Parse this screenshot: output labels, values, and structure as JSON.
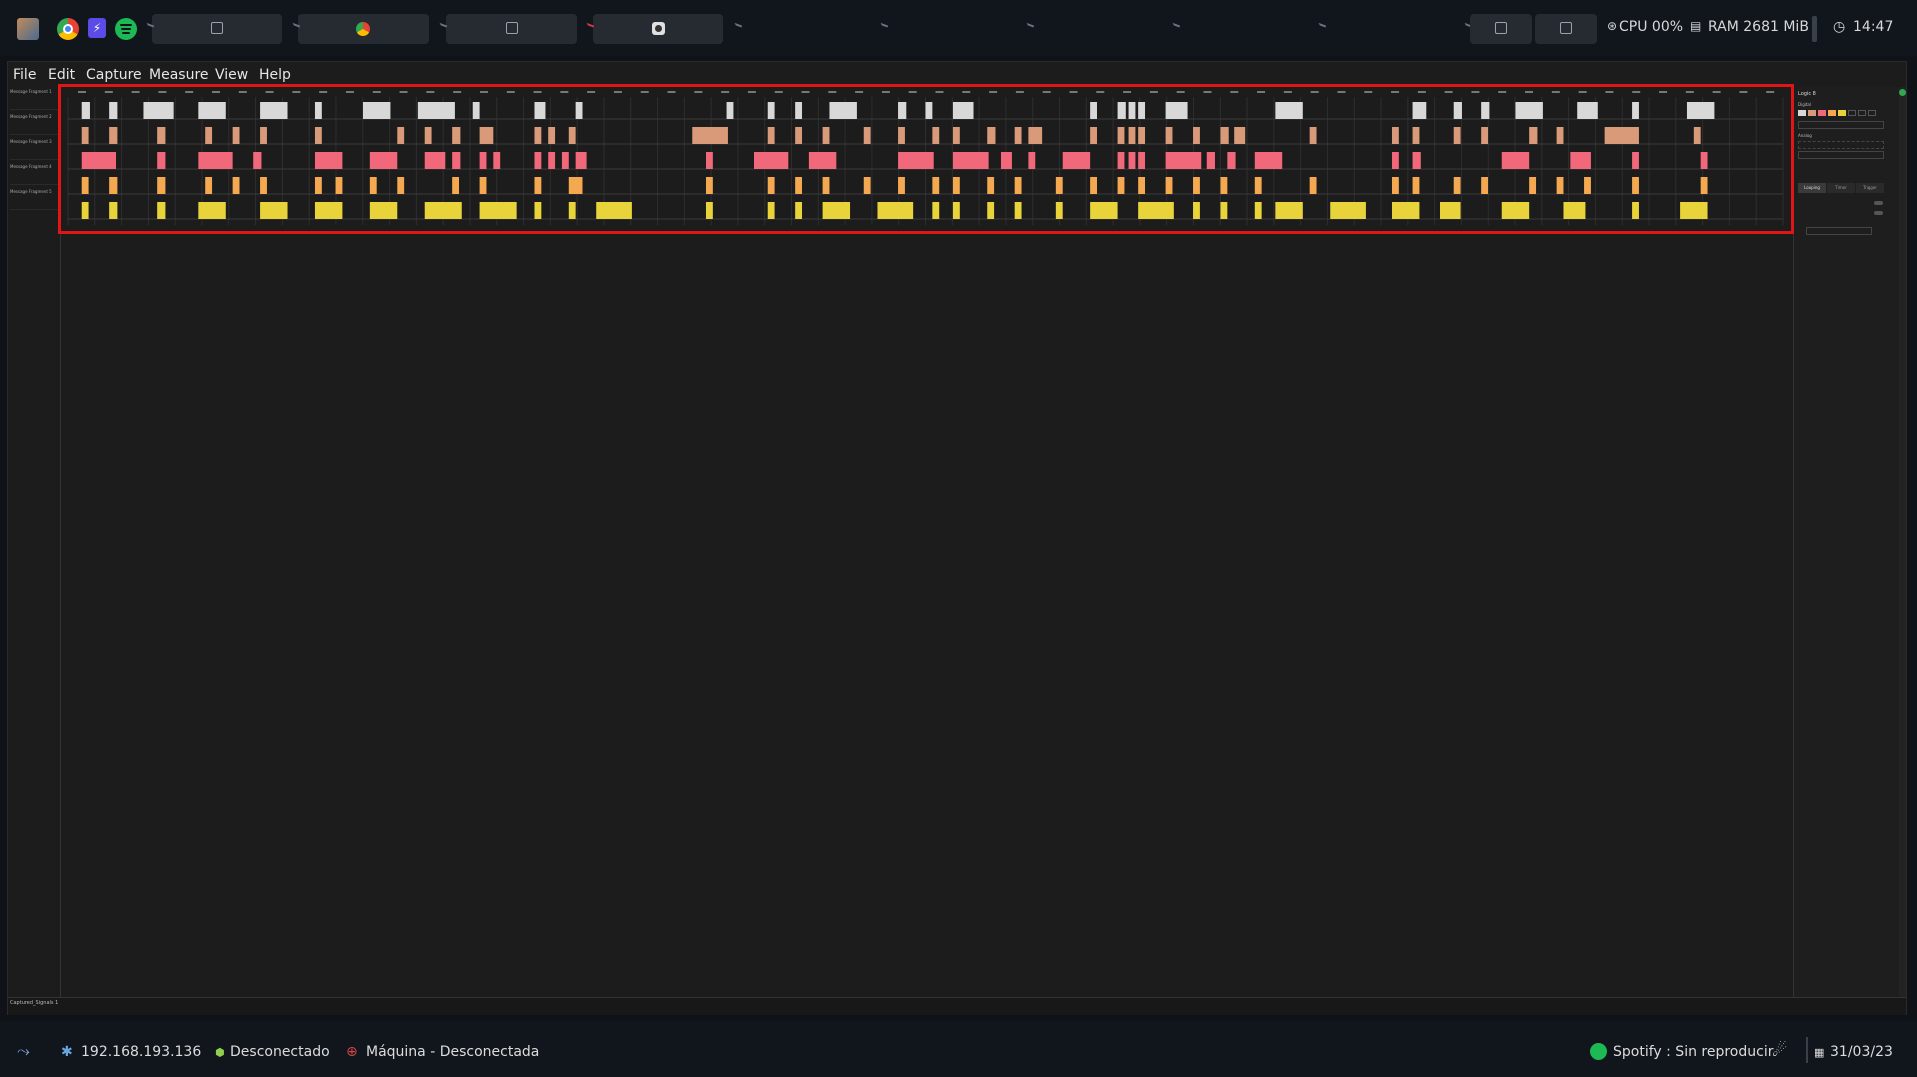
{
  "topbar": {
    "apps": [
      {
        "name": "kali-logo-icon"
      },
      {
        "name": "chrome-icon"
      },
      {
        "name": "burp-icon"
      },
      {
        "name": "spotify-icon"
      }
    ],
    "windows": [
      "terminal",
      "chrome",
      "terminal",
      "logic"
    ],
    "right_windows": [
      "terminal",
      "terminal"
    ],
    "cpu": "CPU 00%",
    "ram": "RAM 2681 MiB",
    "clock": "14:47"
  },
  "menu": [
    "File",
    "Edit",
    "Capture",
    "Measure",
    "View",
    "Help"
  ],
  "channels": [
    {
      "label": "Message Fragment 1",
      "color": "#d8d8d8"
    },
    {
      "label": "Message Fragment 2",
      "color": "#d99a7a"
    },
    {
      "label": "Message Fragment 3",
      "color": "#f0687a"
    },
    {
      "label": "Message Fragment 4",
      "color": "#f4a850"
    },
    {
      "label": "Message Fragment 5",
      "color": "#e8d43a"
    }
  ],
  "pulses": [
    [
      [
        1.0,
        0.6
      ],
      [
        3.0,
        0.6
      ],
      [
        5.5,
        2.2
      ],
      [
        9.5,
        2.0
      ],
      [
        14.0,
        2.0
      ],
      [
        18.0,
        0.5
      ],
      [
        21.5,
        2.0
      ],
      [
        25.5,
        2.7
      ],
      [
        29.5,
        0.5
      ],
      [
        34.0,
        0.8
      ],
      [
        37.0,
        0.5
      ],
      [
        48.0,
        0.5
      ],
      [
        51.0,
        0.5
      ],
      [
        53.0,
        0.5
      ],
      [
        55.5,
        2.0
      ],
      [
        60.5,
        0.6
      ],
      [
        62.5,
        0.5
      ],
      [
        64.5,
        1.5
      ],
      [
        74.5,
        0.5
      ],
      [
        76.5,
        0.6
      ],
      [
        77.3,
        0.5
      ],
      [
        78.0,
        0.5
      ],
      [
        80.0,
        1.6
      ],
      [
        88.0,
        2.0
      ],
      [
        98.0,
        1.0
      ],
      [
        101.0,
        0.6
      ],
      [
        103.0,
        0.6
      ],
      [
        105.5,
        2.0
      ],
      [
        110.0,
        1.5
      ],
      [
        114.0,
        0.5
      ],
      [
        118.0,
        2.0
      ]
    ],
    [
      [
        1.0,
        0.5
      ],
      [
        3.0,
        0.6
      ],
      [
        6.5,
        0.6
      ],
      [
        10.0,
        0.5
      ],
      [
        12.0,
        0.5
      ],
      [
        14.0,
        0.5
      ],
      [
        18.0,
        0.5
      ],
      [
        24.0,
        0.5
      ],
      [
        26.0,
        0.5
      ],
      [
        28.0,
        0.6
      ],
      [
        30.0,
        1.0
      ],
      [
        34.0,
        0.5
      ],
      [
        35.0,
        0.5
      ],
      [
        36.5,
        0.5
      ],
      [
        45.5,
        2.6
      ],
      [
        51.0,
        0.5
      ],
      [
        53.0,
        0.5
      ],
      [
        55.0,
        0.5
      ],
      [
        58.0,
        0.5
      ],
      [
        60.5,
        0.5
      ],
      [
        63.0,
        0.5
      ],
      [
        64.5,
        0.5
      ],
      [
        67.0,
        0.6
      ],
      [
        69.0,
        0.5
      ],
      [
        70.0,
        1.0
      ],
      [
        74.5,
        0.5
      ],
      [
        76.5,
        0.5
      ],
      [
        77.3,
        0.5
      ],
      [
        78.0,
        0.5
      ],
      [
        80.0,
        0.5
      ],
      [
        82.0,
        0.5
      ],
      [
        84.0,
        0.6
      ],
      [
        85.0,
        0.8
      ],
      [
        90.5,
        0.5
      ],
      [
        96.5,
        0.5
      ],
      [
        98.0,
        0.5
      ],
      [
        101.0,
        0.5
      ],
      [
        103.0,
        0.5
      ],
      [
        106.5,
        0.6
      ],
      [
        108.5,
        0.5
      ],
      [
        112.0,
        2.5
      ],
      [
        118.5,
        0.5
      ]
    ],
    [
      [
        1.0,
        2.5
      ],
      [
        6.5,
        0.6
      ],
      [
        9.5,
        2.5
      ],
      [
        13.5,
        0.6
      ],
      [
        18.0,
        2.0
      ],
      [
        22.0,
        2.0
      ],
      [
        26.0,
        1.5
      ],
      [
        28.0,
        0.6
      ],
      [
        30.0,
        0.5
      ],
      [
        31.0,
        0.5
      ],
      [
        34.0,
        0.5
      ],
      [
        35.0,
        0.5
      ],
      [
        36.0,
        0.5
      ],
      [
        37.0,
        0.8
      ],
      [
        46.5,
        0.5
      ],
      [
        50.0,
        2.5
      ],
      [
        54.0,
        2.0
      ],
      [
        60.5,
        2.6
      ],
      [
        64.5,
        2.6
      ],
      [
        68.0,
        0.8
      ],
      [
        70.0,
        0.5
      ],
      [
        72.5,
        2.0
      ],
      [
        76.5,
        0.5
      ],
      [
        77.3,
        0.5
      ],
      [
        78.0,
        0.5
      ],
      [
        80.0,
        2.6
      ],
      [
        83.0,
        0.6
      ],
      [
        84.5,
        0.6
      ],
      [
        86.5,
        2.0
      ],
      [
        96.5,
        0.5
      ],
      [
        98.0,
        0.6
      ],
      [
        104.5,
        2.0
      ],
      [
        109.5,
        1.5
      ],
      [
        114.0,
        0.5
      ],
      [
        119.0,
        0.5
      ]
    ],
    [
      [
        1.0,
        0.5
      ],
      [
        3.0,
        0.6
      ],
      [
        6.5,
        0.6
      ],
      [
        10.0,
        0.5
      ],
      [
        12.0,
        0.5
      ],
      [
        14.0,
        0.5
      ],
      [
        18.0,
        0.5
      ],
      [
        19.5,
        0.5
      ],
      [
        22.0,
        0.5
      ],
      [
        24.0,
        0.5
      ],
      [
        28.0,
        0.5
      ],
      [
        30.0,
        0.5
      ],
      [
        34.0,
        0.5
      ],
      [
        36.5,
        1.0
      ],
      [
        46.5,
        0.5
      ],
      [
        51.0,
        0.5
      ],
      [
        53.0,
        0.5
      ],
      [
        55.0,
        0.5
      ],
      [
        58.0,
        0.5
      ],
      [
        60.5,
        0.5
      ],
      [
        63.0,
        0.5
      ],
      [
        64.5,
        0.5
      ],
      [
        67.0,
        0.5
      ],
      [
        69.0,
        0.5
      ],
      [
        72.0,
        0.5
      ],
      [
        74.5,
        0.5
      ],
      [
        76.5,
        0.5
      ],
      [
        78.0,
        0.5
      ],
      [
        80.0,
        0.5
      ],
      [
        82.0,
        0.5
      ],
      [
        84.0,
        0.5
      ],
      [
        86.5,
        0.5
      ],
      [
        90.5,
        0.5
      ],
      [
        96.5,
        0.5
      ],
      [
        98.0,
        0.5
      ],
      [
        101.0,
        0.5
      ],
      [
        103.0,
        0.5
      ],
      [
        106.5,
        0.5
      ],
      [
        108.5,
        0.5
      ],
      [
        110.5,
        0.5
      ],
      [
        114.0,
        0.5
      ],
      [
        119.0,
        0.5
      ]
    ],
    [
      [
        1.0,
        0.5
      ],
      [
        3.0,
        0.6
      ],
      [
        6.5,
        0.6
      ],
      [
        9.5,
        2.0
      ],
      [
        14.0,
        2.0
      ],
      [
        18.0,
        2.0
      ],
      [
        22.0,
        2.0
      ],
      [
        26.0,
        2.7
      ],
      [
        30.0,
        2.7
      ],
      [
        34.0,
        0.5
      ],
      [
        36.5,
        0.5
      ],
      [
        38.5,
        2.6
      ],
      [
        46.5,
        0.5
      ],
      [
        51.0,
        0.5
      ],
      [
        53.0,
        0.5
      ],
      [
        55.0,
        2.0
      ],
      [
        59.0,
        2.6
      ],
      [
        63.0,
        0.5
      ],
      [
        64.5,
        0.5
      ],
      [
        67.0,
        0.5
      ],
      [
        69.0,
        0.5
      ],
      [
        72.0,
        0.5
      ],
      [
        74.5,
        2.0
      ],
      [
        78.0,
        2.6
      ],
      [
        82.0,
        0.5
      ],
      [
        84.0,
        0.5
      ],
      [
        86.5,
        0.5
      ],
      [
        88.0,
        2.0
      ],
      [
        92.0,
        2.6
      ],
      [
        96.5,
        2.0
      ],
      [
        100.0,
        1.5
      ],
      [
        104.5,
        2.0
      ],
      [
        109.0,
        1.6
      ],
      [
        114.0,
        0.5
      ],
      [
        117.5,
        2.0
      ]
    ]
  ],
  "right_panel": {
    "title": "Logic 8",
    "digital_label": "Digital",
    "analog_label": "Analog",
    "tabs": [
      "Looping",
      "Timer",
      "Trigger"
    ]
  },
  "capture_tab": "Captured_Signals 1",
  "bottombar": {
    "ip": "192.168.193.136",
    "vpn": "Desconectado",
    "target": "Máquina - Desconectada",
    "spotify": "Spotify : Sin reproducir",
    "date": "31/03/23"
  }
}
